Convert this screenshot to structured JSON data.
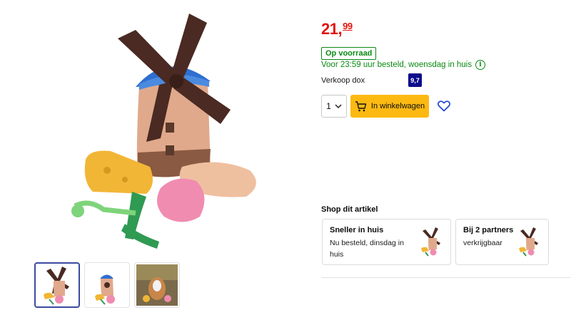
{
  "product": {
    "price_whole": "21,",
    "price_cents": "99",
    "stock_badge": "Op voorraad",
    "delivery_text": "Voor 23:59 uur besteld, woensdag in huis",
    "seller_label": "Verkoop dox",
    "seller_rating": "9,7",
    "quantity": "1",
    "add_to_cart_label": "In winkelwagen"
  },
  "shop_article": {
    "heading": "Shop dit artikel",
    "cards": [
      {
        "title": "Sneller in huis",
        "subtitle": "Nu besteld, dinsdag in huis"
      },
      {
        "title": "Bij 2 partners",
        "subtitle": "verkrijgbaar"
      }
    ]
  },
  "colors": {
    "price": "#e0140e",
    "stock_green": "#0a8a13",
    "cart_button": "#fcb912",
    "rating_badge": "#0c0c8c",
    "heart": "#1a3fd1"
  },
  "icons": [
    "info-icon",
    "chevron-down-icon",
    "cart-icon",
    "heart-icon"
  ]
}
